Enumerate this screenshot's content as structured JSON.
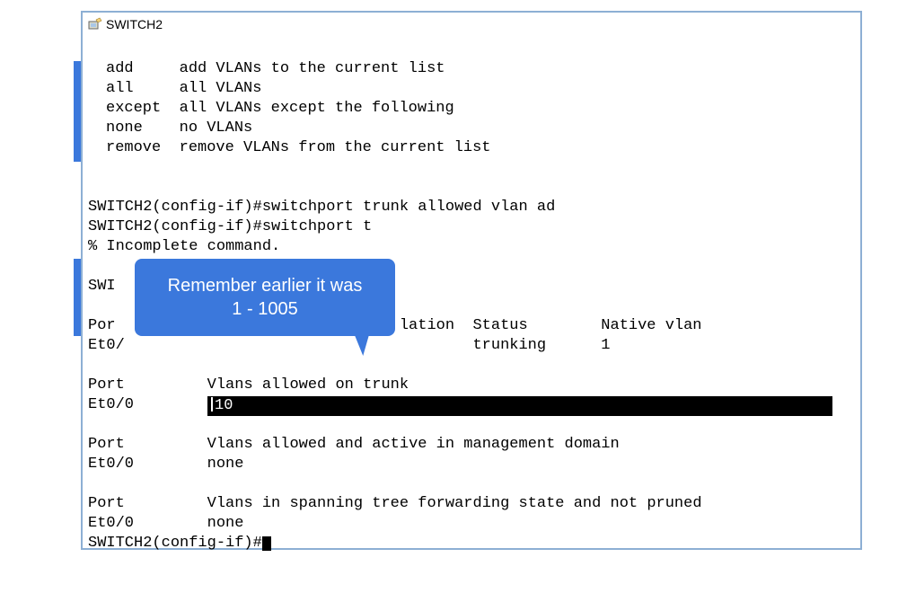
{
  "window_title": "SWITCH2",
  "help": {
    "add_key": "add",
    "add_desc": "add VLANs to the current list",
    "all_key": "all",
    "all_desc": "all VLANs",
    "except_key": "except",
    "except_desc": "all VLANs except the following",
    "none_key": "none",
    "none_desc": "no VLANs",
    "remove_key": "remove",
    "remove_desc": "remove VLANs from the current list"
  },
  "lines": {
    "l1": "SWITCH2(config-if)#switchport trunk allowed vlan ad",
    "l2": "SWITCH2(config-if)#switchport t",
    "l3": "% Incomplete command.",
    "l4": "SWI",
    "l5": "Por                               lation  Status        Native vlan",
    "l6": "Et0/                                      trunking      1",
    "l7_port": "Port",
    "l7_label": "Vlans allowed on trunk",
    "l8_port": "Et0/0",
    "l8_val": "10",
    "l9_port": "Port",
    "l9_label": "Vlans allowed and active in management domain",
    "l10_port": "Et0/0",
    "l10_val": "none",
    "l11_port": "Port",
    "l11_label": "Vlans in spanning tree forwarding state and not pruned",
    "l12_port": "Et0/0",
    "l12_val": "none",
    "l13": "SWITCH2(config-if)#"
  },
  "callout_text": "Remember earlier it was\n1 - 1005"
}
